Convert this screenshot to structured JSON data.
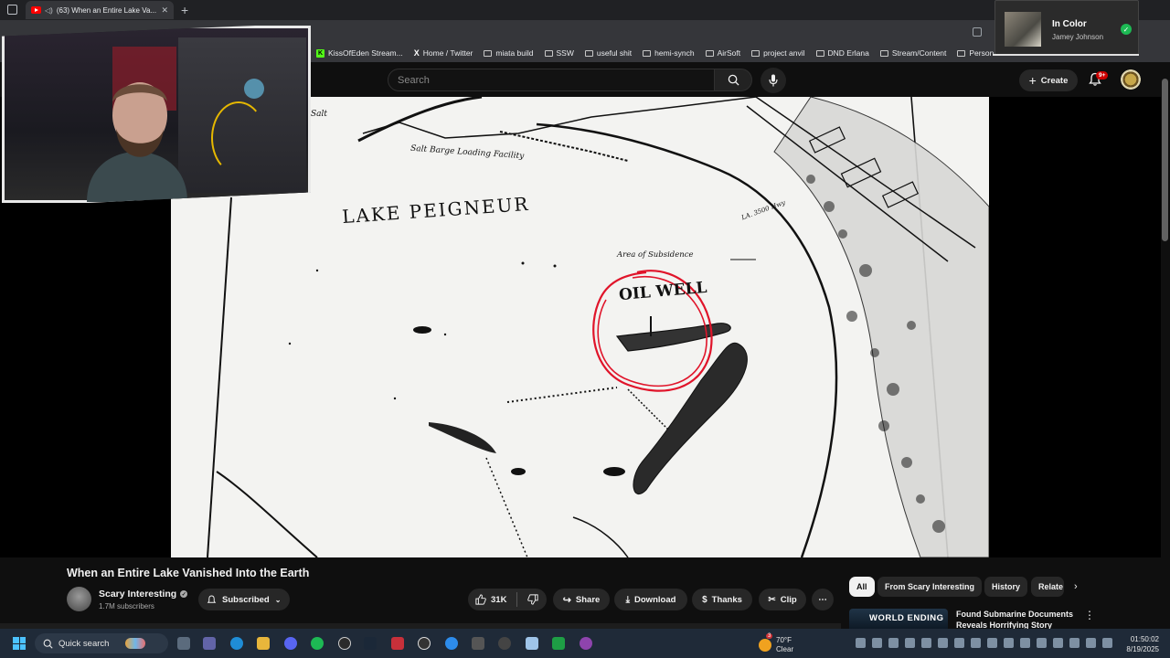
{
  "browser": {
    "tab_title": "(63) When an Entire Lake Va...",
    "bookmarks": [
      {
        "label": "KissOfEden Stream...",
        "icon": "kick-icon"
      },
      {
        "label": "Home / Twitter",
        "icon": "x-icon"
      },
      {
        "label": "miata build",
        "icon": "folder-icon"
      },
      {
        "label": "SSW",
        "icon": "folder-icon"
      },
      {
        "label": "useful shit",
        "icon": "folder-icon"
      },
      {
        "label": "hemi-synch",
        "icon": "folder-icon"
      },
      {
        "label": "AirSoft",
        "icon": "folder-icon"
      },
      {
        "label": "project anvil",
        "icon": "folder-icon"
      },
      {
        "label": "DND Erlana",
        "icon": "folder-icon"
      },
      {
        "label": "Stream/Content",
        "icon": "folder-icon"
      },
      {
        "label": "Personal Dr",
        "icon": "folder-icon"
      }
    ]
  },
  "masthead": {
    "search_placeholder": "Search",
    "create_label": "Create",
    "notifications_badge": "9+"
  },
  "now_playing": {
    "song": "In Color",
    "artist": "Jamey Johnson"
  },
  "video_map": {
    "title": "LAKE PEIGNEUR",
    "oil_well": "OIL WELL",
    "loading": "Salt Barge Loading Facility",
    "subsidence": "Area of Subsidence",
    "road": "LA. 3500 Hwy",
    "corner": "Salt",
    "accent_color": "#e0142a"
  },
  "watch": {
    "title": "When an Entire Lake Vanished Into the Earth",
    "channel": "Scary Interesting",
    "subscribers": "1.7M subscribers",
    "subscribed_label": "Subscribed",
    "likes": "31K",
    "share_label": "Share",
    "download_label": "Download",
    "thanks_label": "Thanks",
    "clip_label": "Clip"
  },
  "related": {
    "chips": [
      "All",
      "From Scary Interesting",
      "History",
      "Relate"
    ],
    "first_video_title": "Found Submarine Documents Reveals Horrifying Story",
    "first_thumb_text": "WORLD ENDING"
  },
  "taskbar": {
    "search_label": "Quick search",
    "weather_temp": "70°F",
    "weather_cond": "Clear",
    "weather_badge": "3",
    "time": "01:50:02",
    "date": "8/19/2025"
  }
}
